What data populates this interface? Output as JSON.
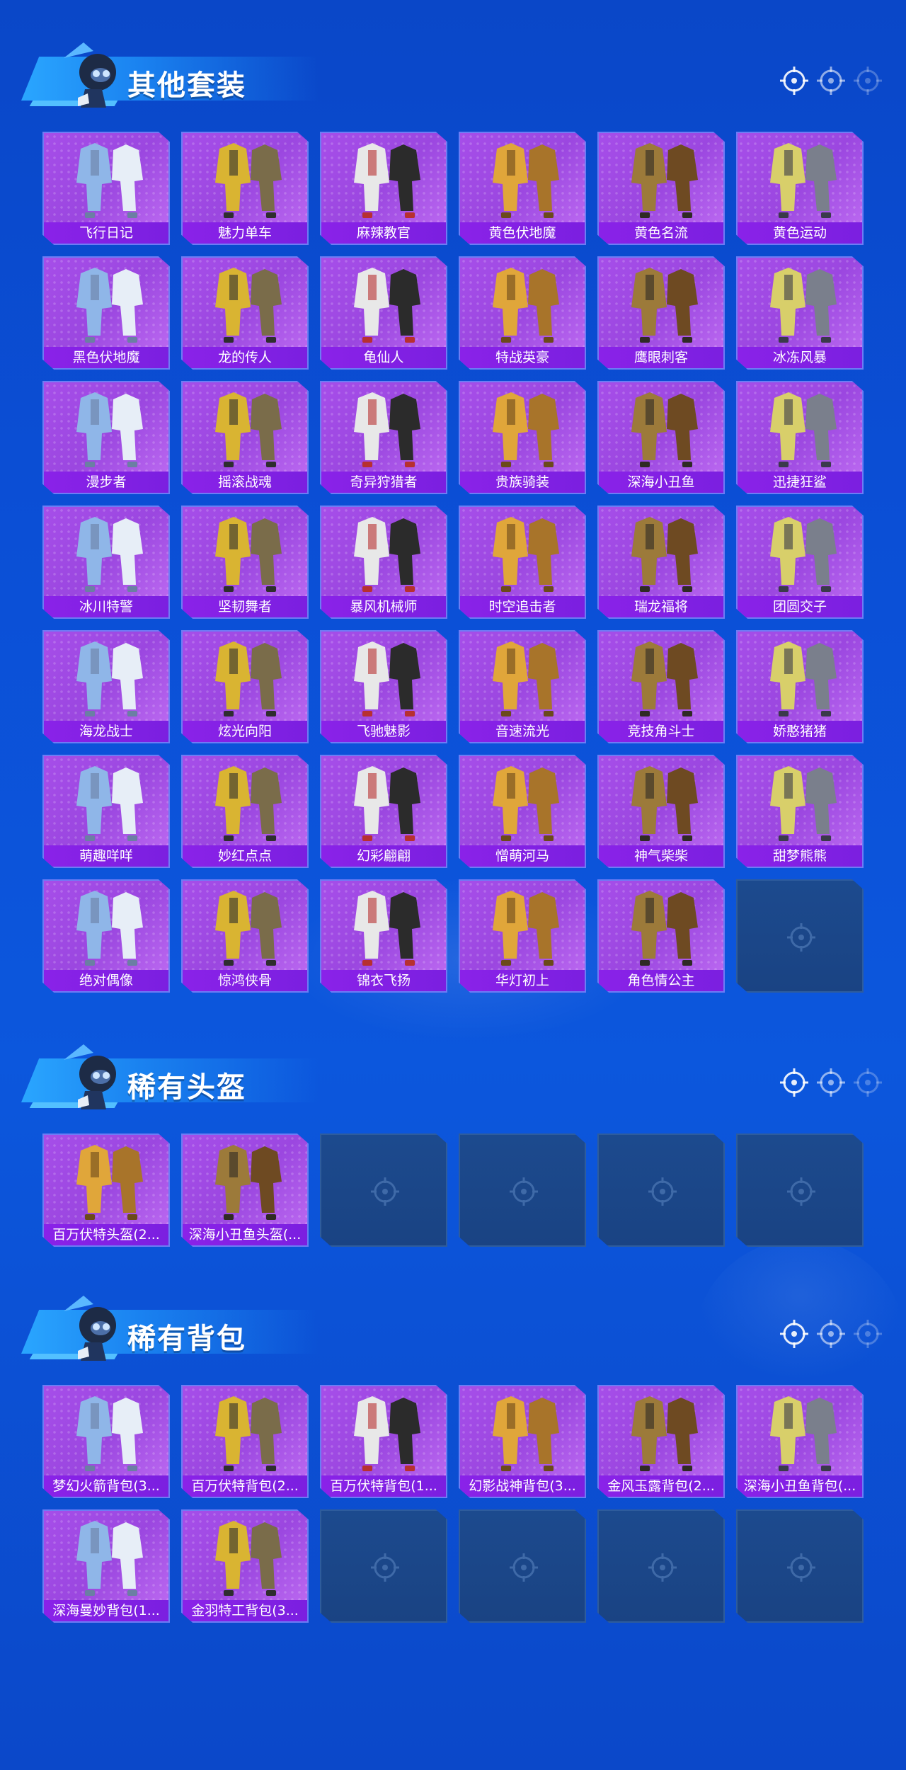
{
  "sections": [
    {
      "title": "其他套装",
      "items": [
        "飞行日记",
        "魅力单车",
        "麻辣教官",
        "黄色伏地魔",
        "黄色名流",
        "黄色运动",
        "黑色伏地魔",
        "龙的传人",
        "龟仙人",
        "特战英豪",
        "鹰眼刺客",
        "冰冻风暴",
        "漫步者",
        "摇滚战魂",
        "奇异狩猎者",
        "贵族骑装",
        "深海小丑鱼",
        "迅捷狂鲨",
        "冰川特警",
        "坚韧舞者",
        "暴风机械师",
        "时空追击者",
        "瑞龙福将",
        "团圆交子",
        "海龙战士",
        "炫光向阳",
        "飞驰魅影",
        "音速流光",
        "竞技角斗士",
        "娇憨猪猪",
        "萌趣咩咩",
        "妙红点点",
        "幻彩翩翩",
        "憎萌河马",
        "神气柴柴",
        "甜梦熊熊",
        "绝对偶像",
        "惊鸿侠骨",
        "锦衣飞扬",
        "华灯初上",
        "角色情公主",
        ""
      ]
    },
    {
      "title": "稀有头盔",
      "items": [
        "百万伏特头盔(2...",
        "深海小丑鱼头盔(...",
        "",
        "",
        "",
        ""
      ]
    },
    {
      "title": "稀有背包",
      "items": [
        "梦幻火箭背包(3...",
        "百万伏特背包(2...",
        "百万伏特背包(1...",
        "幻影战神背包(3...",
        "金风玉露背包(2...",
        "深海小丑鱼背包(...",
        "深海曼妙背包(1...",
        "金羽特工背包(3...",
        "",
        "",
        "",
        ""
      ]
    }
  ],
  "colors": {
    "background": "#0b4fd6",
    "card_purple": "#a64ee9",
    "label_bar": "#8a22e8",
    "empty_slot": "#1c4a8e"
  },
  "icons": {
    "section_mascot": "mascot-icon",
    "header_target": "crosshair-icon",
    "empty_slot": "crosshair-icon"
  }
}
